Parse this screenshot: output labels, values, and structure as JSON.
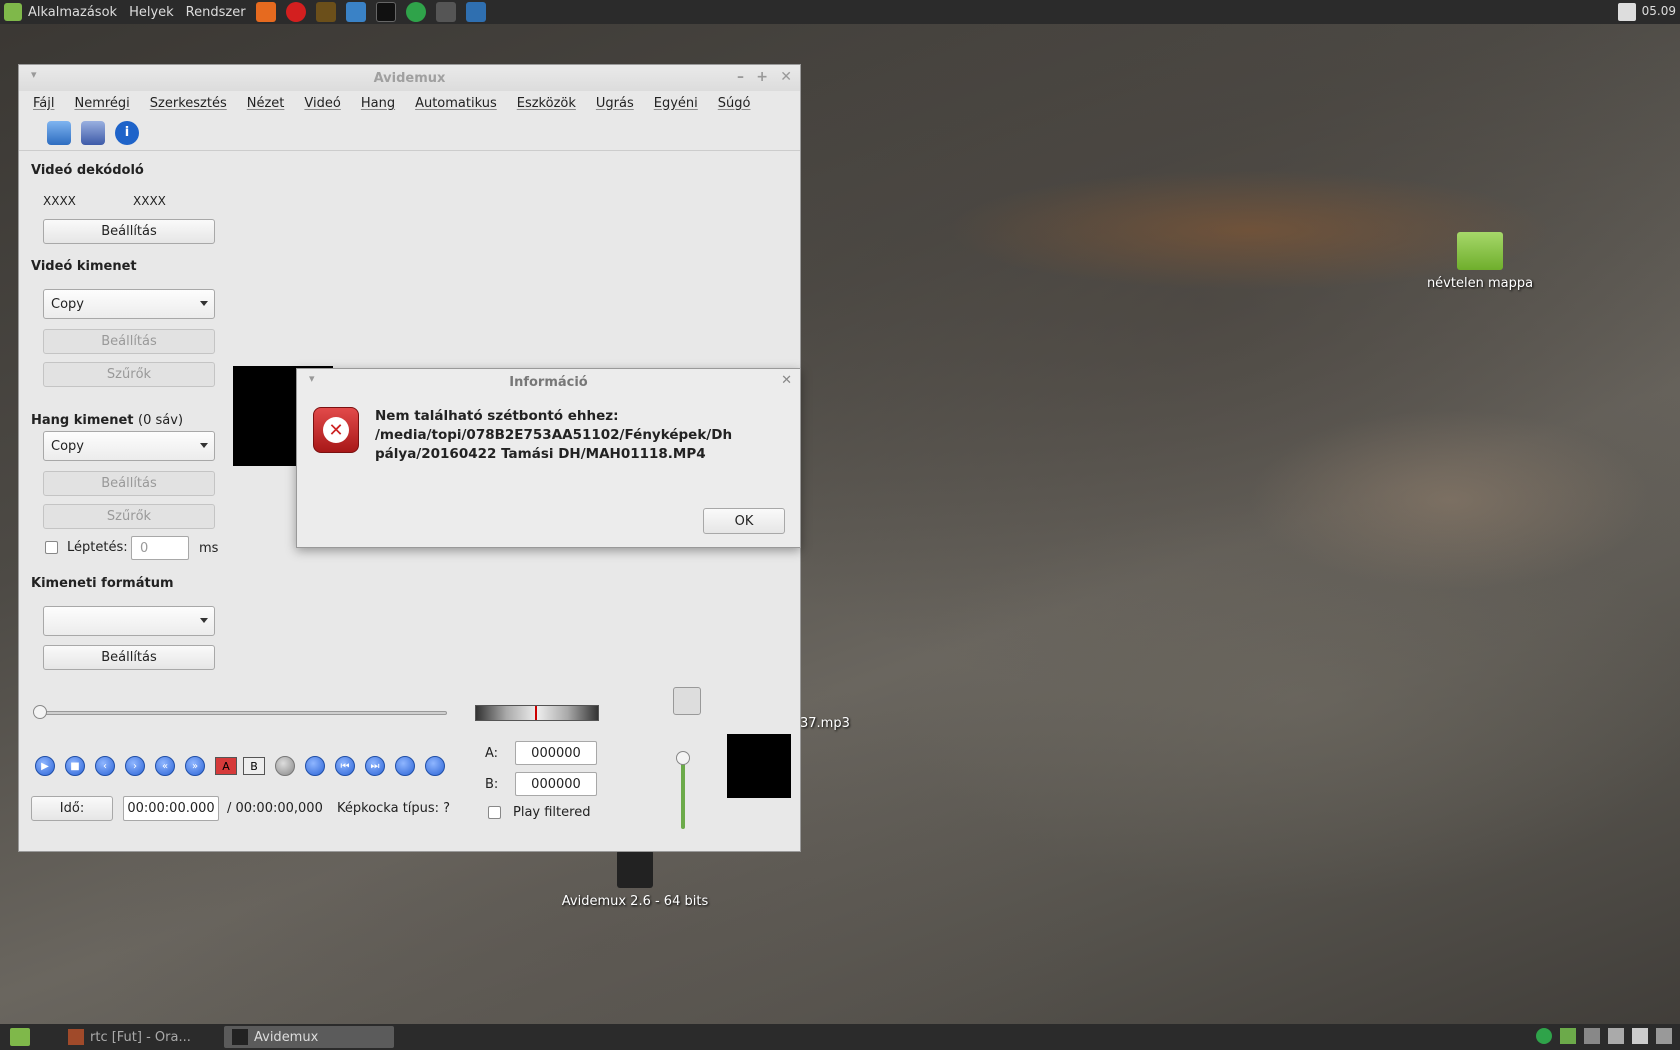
{
  "top_panel": {
    "menu": [
      "Alkalmazások",
      "Helyek",
      "Rendszer"
    ],
    "clock": "05.09"
  },
  "desktop": {
    "folder_label": "névtelen mappa",
    "mp3_label": "37.mp3",
    "avidemux_label": "Avidemux 2.6 - 64 bits"
  },
  "taskbar": {
    "task1": "rtc [Fut] - Ora...",
    "task2": "Avidemux"
  },
  "window": {
    "title": "Avidemux",
    "menu": [
      "Fájl",
      "Nemrégi",
      "Szerkesztés",
      "Nézet",
      "Videó",
      "Hang",
      "Automatikus",
      "Eszközök",
      "Ugrás",
      "Egyéni",
      "Súgó"
    ],
    "video_decoder": {
      "heading": "Videó dekódoló",
      "v1": "XXXX",
      "v2": "XXXX",
      "settings": "Beállítás"
    },
    "video_output": {
      "heading": "Videó kimenet",
      "codec": "Copy",
      "settings": "Beállítás",
      "filters": "Szűrők"
    },
    "audio_output": {
      "heading": "Hang kimenet",
      "tracks": "(0 sáv)",
      "codec": "Copy",
      "settings": "Beállítás",
      "filters": "Szűrők",
      "shift_label": "Léptetés:",
      "shift_value": "0",
      "shift_unit": "ms"
    },
    "output_format": {
      "heading": "Kimeneti formátum",
      "value": "",
      "settings": "Beállítás"
    },
    "time_button": "Idő:",
    "time_value": "00:00:00.000",
    "time_total": "/ 00:00:00,000",
    "frame_type": "Képkocka típus:  ?",
    "marker_a_label": "A:",
    "marker_a_value": "000000",
    "marker_b_label": "B:",
    "marker_b_value": "000000",
    "play_filtered": "Play filtered"
  },
  "dialog": {
    "title": "Információ",
    "line1": "Nem található szétbontó ehhez:",
    "line2": "/media/topi/078B2E753AA51102/Fényképek/Dh",
    "line3": "pálya/20160422 Tamási DH/MAH01118.MP4",
    "ok": "OK"
  }
}
